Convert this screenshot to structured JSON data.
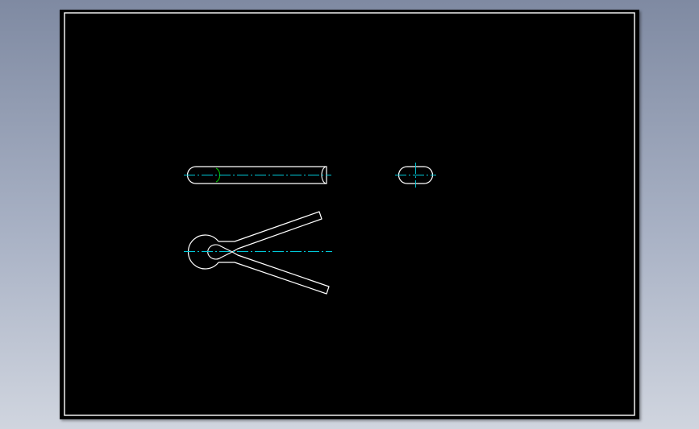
{
  "colors": {
    "background_top": "#7f8aa2",
    "background_bottom": "#d0d5df",
    "sheet": "#000000",
    "frame": "#ffffff",
    "outline": "#ffffff",
    "centerline": "#00c8d8",
    "arc_mark": "#00c000"
  },
  "views": [
    {
      "name": "front-view",
      "part": "cotter-pin-straight"
    },
    {
      "name": "end-view",
      "part": "cotter-pin-section"
    },
    {
      "name": "top-view",
      "part": "cotter-pin-spread-legs"
    }
  ]
}
